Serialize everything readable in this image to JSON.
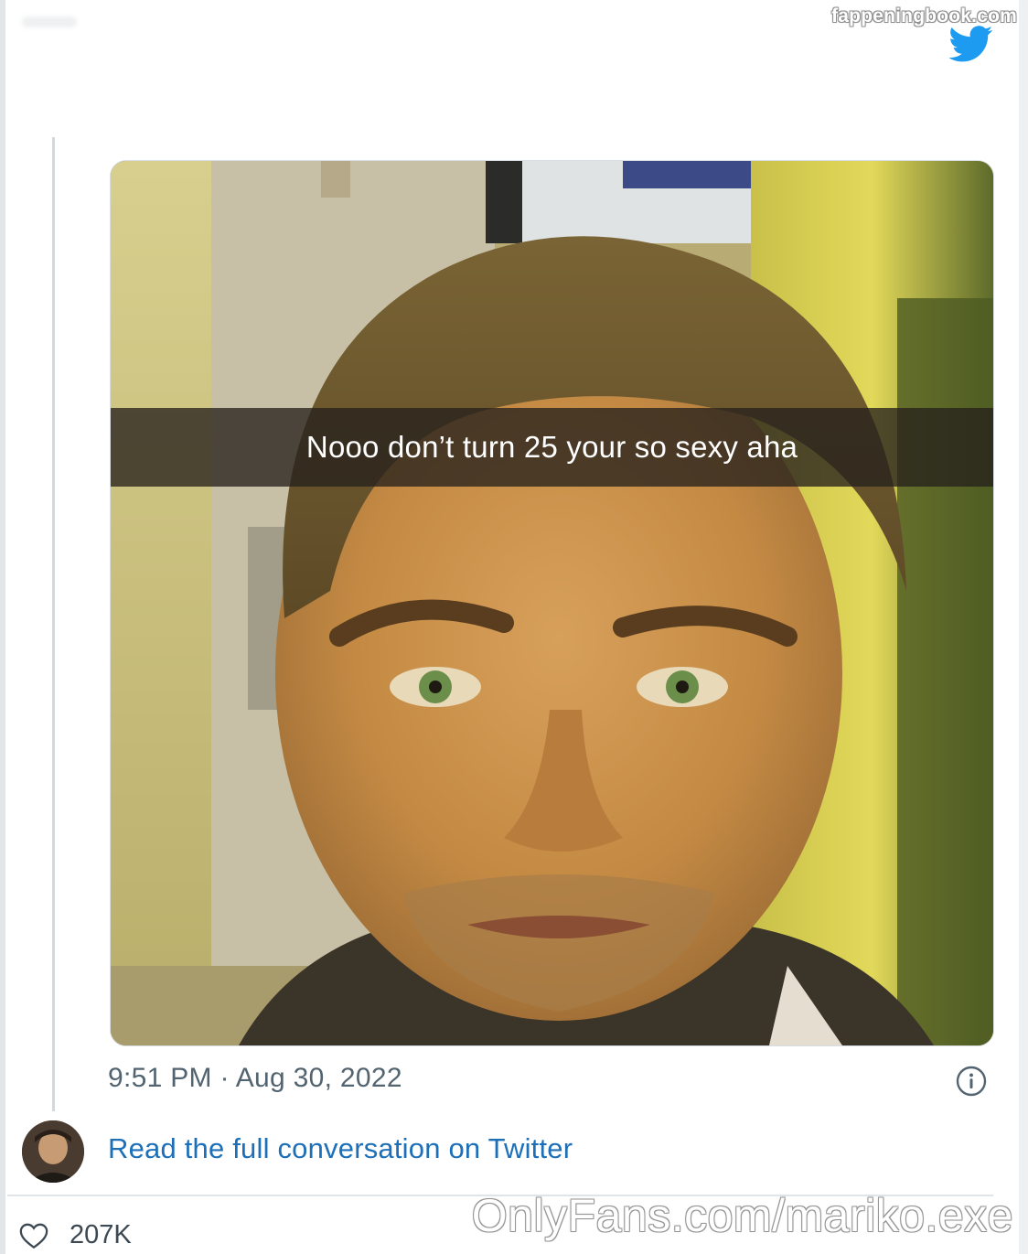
{
  "watermark_top": "fappeningbook.com",
  "watermark_bottom": "OnlyFans.com/mariko.exe",
  "tweet": {
    "image_caption": "Nooo don’t turn 25 your so sexy aha",
    "timestamp": "9:51 PM · Aug 30, 2022",
    "read_more_label": "Read the full conversation on Twitter",
    "like_count": "207K"
  },
  "icons": {
    "brand": "twitter-bird-icon",
    "info": "info-icon",
    "like": "heart-icon"
  },
  "colors": {
    "twitter_blue": "#1d9bf0",
    "link": "#1d6fb8",
    "muted_text": "#536471"
  }
}
